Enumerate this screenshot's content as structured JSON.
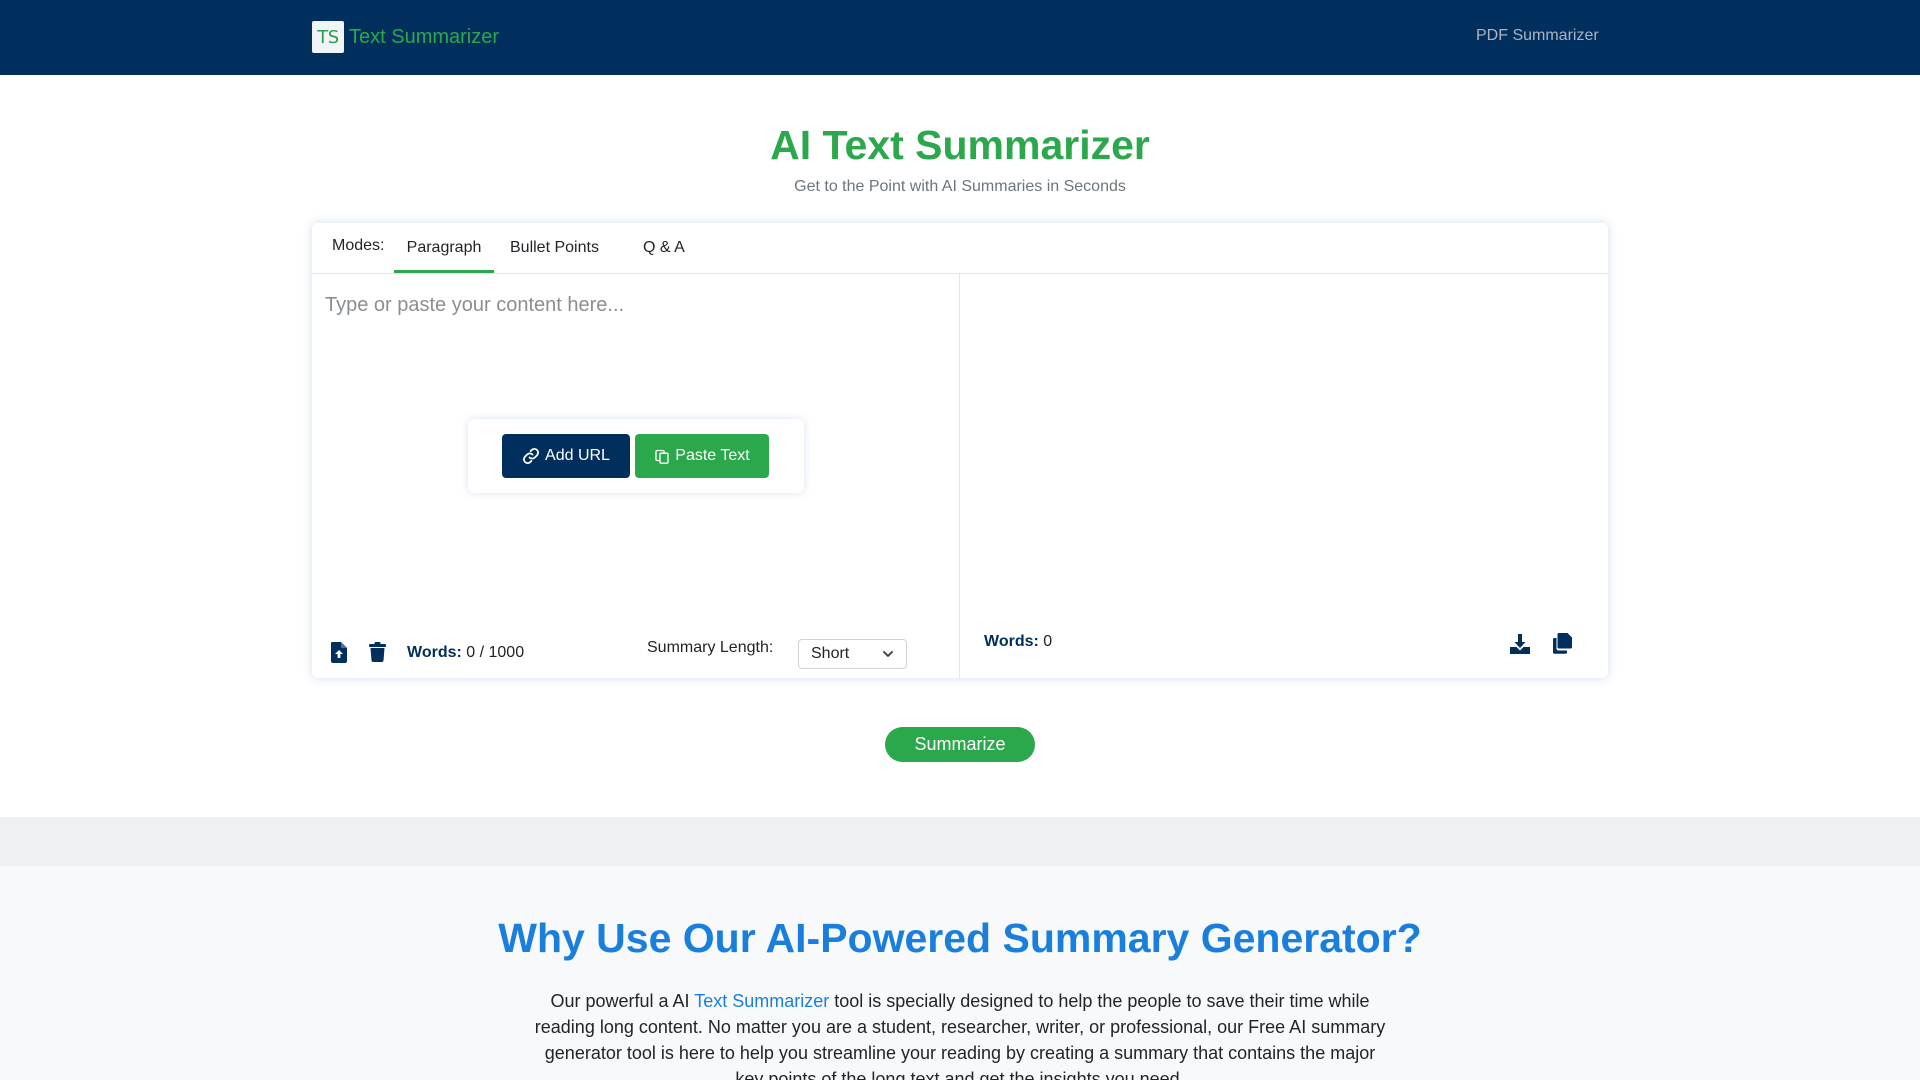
{
  "nav": {
    "logo_text": "TS",
    "brand": "Text Summarizer",
    "links": [
      "PDF Summarizer"
    ]
  },
  "hero": {
    "title": "AI Text Summarizer",
    "subtitle": "Get to the Point with AI Summaries in Seconds"
  },
  "modes": {
    "label": "Modes:",
    "tabs": [
      "Paragraph",
      "Bullet Points",
      "Q & A"
    ],
    "active": "Paragraph"
  },
  "input": {
    "placeholder": "Type or paste your content here...",
    "value": "",
    "add_url": "Add URL",
    "paste_text": "Paste Text",
    "words_label": "Words:",
    "words_count": "0 / 1000",
    "length_label": "Summary Length:",
    "length_value": "Short"
  },
  "output": {
    "words_label": "Words:",
    "words_count": "0"
  },
  "summarize": "Summarize",
  "why": {
    "title": "Why Use Our AI-Powered Summary Generator?",
    "text_before": "Our powerful a AI ",
    "link": "Text Summarizer",
    "text_after": " tool is specially designed to help the people to save their time while reading long content. No matter you are a student, researcher, writer, or professional, our Free AI summary generator tool is here to help you streamline your reading by creating a summary that contains the major key points of the long text and get the insights you need."
  },
  "colors": {
    "navy": "#002f5e",
    "green": "#2ca84c",
    "blue": "#1a7fdc"
  },
  "icons": [
    "link-icon",
    "clipboard-icon",
    "file-upload-icon",
    "trash-icon",
    "chevron-down-icon",
    "download-icon",
    "copy-icon"
  ]
}
